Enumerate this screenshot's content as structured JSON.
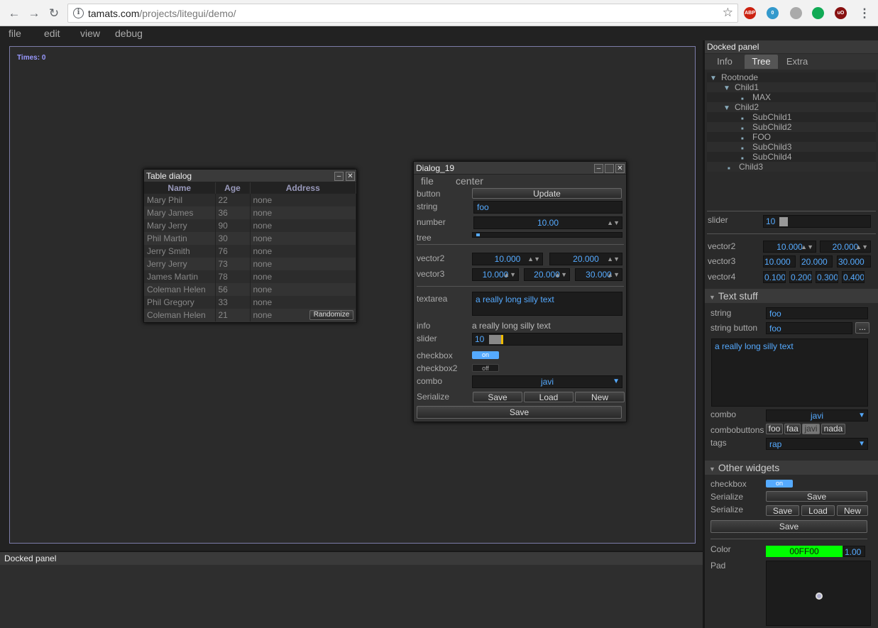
{
  "browser": {
    "url_host": "tamats.com",
    "url_path": "/projects/litegui/demo/",
    "extensions": [
      {
        "name": "adblock-plus-icon",
        "label": "ABP",
        "color": "#c21"
      },
      {
        "name": "ghostery-icon",
        "label": "0",
        "color": "#39c"
      },
      {
        "name": "extension-icon",
        "label": "",
        "color": "#aaa"
      },
      {
        "name": "leaf-icon",
        "label": "",
        "color": "#1a5"
      },
      {
        "name": "ublock-icon",
        "label": "uO",
        "color": "#811"
      }
    ]
  },
  "menu": [
    "file",
    "edit",
    "view",
    "debug"
  ],
  "canvas": {
    "times": "Times: 0"
  },
  "table_dialog": {
    "title": "Table dialog",
    "columns": [
      "Name",
      "Age",
      "Address"
    ],
    "rows": [
      [
        "Mary Phil",
        "22",
        "none"
      ],
      [
        "Mary James",
        "36",
        "none"
      ],
      [
        "Mary Jerry",
        "90",
        "none"
      ],
      [
        "Phil Martin",
        "30",
        "none"
      ],
      [
        "Jerry Smith",
        "76",
        "none"
      ],
      [
        "Jerry Jerry",
        "73",
        "none"
      ],
      [
        "James Martin",
        "78",
        "none"
      ],
      [
        "Coleman Helen",
        "56",
        "none"
      ],
      [
        "Phil Gregory",
        "33",
        "none"
      ],
      [
        "Coleman Helen",
        "21",
        "none"
      ]
    ],
    "randomize": "Randomize"
  },
  "dialog19": {
    "title": "Dialog_19",
    "menu": [
      "file",
      "center"
    ],
    "labels": {
      "button": "button",
      "string": "string",
      "number": "number",
      "tree": "tree",
      "vector2": "vector2",
      "vector3": "vector3",
      "textarea": "textarea",
      "info": "info",
      "slider": "slider",
      "checkbox": "checkbox",
      "checkbox2": "checkbox2",
      "combo": "combo",
      "serialize": "Serialize"
    },
    "update": "Update",
    "string_value": "foo",
    "number_value": "10.00",
    "vector2": [
      "10.000",
      "20.000"
    ],
    "vector3": [
      "10.000",
      "20.000",
      "30.000"
    ],
    "textarea": "a really long silly text",
    "info": "a really long silly text",
    "slider_value": "10",
    "slider_fraction": 0.1,
    "checkbox": "on",
    "checkbox2": "off",
    "combo": "javi",
    "save": "Save",
    "load": "Load",
    "new": "New",
    "save_full": "Save"
  },
  "right_panel": {
    "title": "Docked panel",
    "tabs": [
      "Info",
      "Tree",
      "Extra"
    ],
    "tree": [
      {
        "label": "Rootnode",
        "depth": 0,
        "kind": "open"
      },
      {
        "label": "Child1",
        "depth": 1,
        "kind": "open"
      },
      {
        "label": "MAX",
        "depth": 2,
        "kind": "leaf"
      },
      {
        "label": "Child2",
        "depth": 1,
        "kind": "open"
      },
      {
        "label": "SubChild1",
        "depth": 2,
        "kind": "leaf"
      },
      {
        "label": "SubChild2",
        "depth": 2,
        "kind": "leaf"
      },
      {
        "label": "FOO",
        "depth": 2,
        "kind": "leaf"
      },
      {
        "label": "SubChild3",
        "depth": 2,
        "kind": "leaf"
      },
      {
        "label": "SubChild4",
        "depth": 2,
        "kind": "leaf"
      },
      {
        "label": "Child3",
        "depth": 1,
        "kind": "leaf"
      }
    ],
    "slider_label": "slider",
    "slider_value": "10",
    "slider_fraction": 0.1,
    "vector2_label": "vector2",
    "vector2": [
      "10.000",
      "20.000"
    ],
    "vector3_label": "vector3",
    "vector3": [
      "10.000",
      "20.000",
      "30.000"
    ],
    "vector4_label": "vector4",
    "vector4": [
      "0.100",
      "0.200",
      "0.300",
      "0.400"
    ],
    "text_stuff": "Text stuff",
    "string_label": "string",
    "string_value": "foo",
    "string_button_label": "string button",
    "string_button_value": "foo",
    "dots": "...",
    "textarea": "a really long silly text",
    "combo_label": "combo",
    "combo_value": "javi",
    "combobuttons_label": "combobuttons",
    "combobuttons": [
      "foo",
      "faa",
      "javi",
      "nada"
    ],
    "tags_label": "tags",
    "tags_value": "rap",
    "other_widgets": "Other widgets",
    "checkbox_label": "checkbox",
    "checkbox_value": "on",
    "serialize_label": "Serialize",
    "save": "Save",
    "load": "Load",
    "new": "New",
    "color_label": "Color",
    "color_value": "00FF00",
    "color_hex": "#00FF00",
    "alpha": "1.00",
    "pad_label": "Pad"
  },
  "bottom_panel": {
    "title": "Docked panel"
  }
}
